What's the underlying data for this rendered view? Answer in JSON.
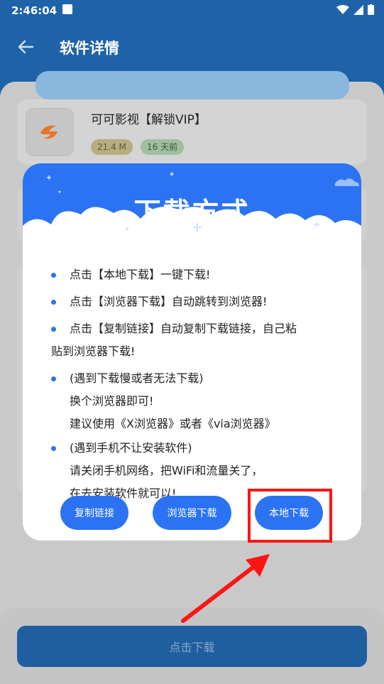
{
  "status": {
    "time": "2:46:04"
  },
  "header": {
    "title": "软件详情"
  },
  "app": {
    "name": "可可影视【解锁VIP】",
    "size": "21.4 M",
    "updated": "16 天前"
  },
  "dialog": {
    "title": "下载方式",
    "items": [
      {
        "lines": [
          "点击【本地下载】一键下载!"
        ]
      },
      {
        "lines": [
          "点击【浏览器下载】自动跳转到浏览器!"
        ]
      },
      {
        "lines": [
          "点击【复制链接】自动复制下载链接，自己粘",
          "贴到浏览器下载!"
        ]
      },
      {
        "lines": [
          "(遇到下载慢或者无法下载)",
          "换个浏览器即可!",
          "建议使用《X浏览器》或者《via浏览器》"
        ]
      },
      {
        "lines": [
          "(遇到手机不让安装软件)",
          "请关闭手机网络，把WiFi和流量关了，",
          "在去安装软件就可以!"
        ]
      }
    ],
    "buttons": {
      "copy": "复制链接",
      "browser": "浏览器下载",
      "local": "本地下载"
    }
  },
  "footer": {
    "download_label": "点击下载"
  },
  "colors": {
    "primary": "#2b73f2",
    "app_bar": "#1e63a8",
    "highlight": "#ff1414"
  },
  "icons": [
    "back-arrow-icon",
    "wifi-icon",
    "signal-icon",
    "battery-icon",
    "app-logo-icon",
    "cloud-icon",
    "star-icon"
  ]
}
